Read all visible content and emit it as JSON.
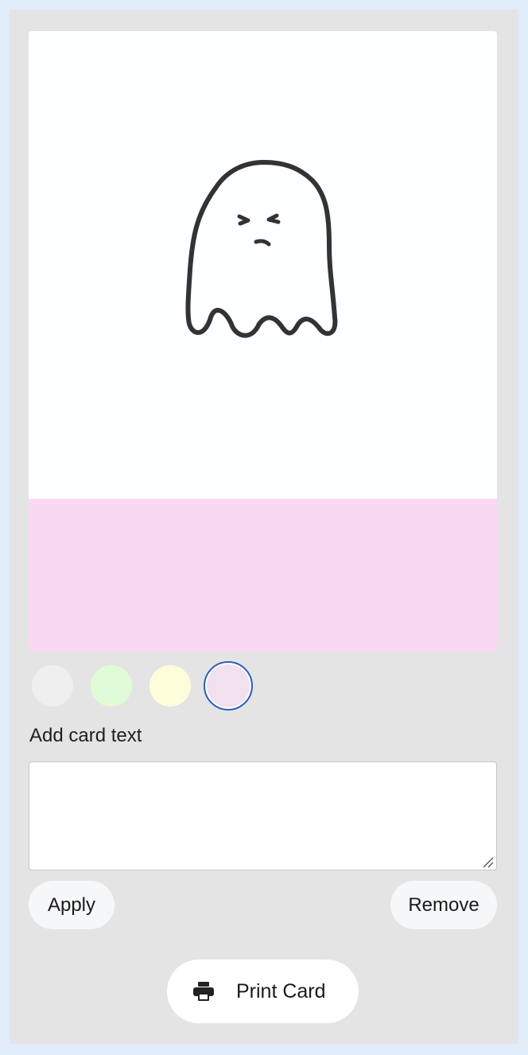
{
  "card": {
    "image_icon": "ghost-doodle",
    "background_color": "#fdfeff",
    "text_area_color": "#f9d8f4"
  },
  "swatches": [
    {
      "name": "light-gray",
      "color": "#efefef",
      "selected": false
    },
    {
      "name": "light-green",
      "color": "#e0fcd7",
      "selected": false
    },
    {
      "name": "light-yellow",
      "color": "#fdfed9",
      "selected": false
    },
    {
      "name": "light-pink",
      "color": "#f1e0ee",
      "selected": true
    }
  ],
  "text_editor": {
    "label": "Add card text",
    "value": "",
    "placeholder": ""
  },
  "actions": {
    "apply_label": "Apply",
    "remove_label": "Remove",
    "print_label": "Print Card",
    "print_icon": "printer-icon"
  },
  "colors": {
    "page_background": "#e1edfb",
    "panel_background": "#e4e4e4",
    "selected_ring": "#2a5fc0"
  }
}
